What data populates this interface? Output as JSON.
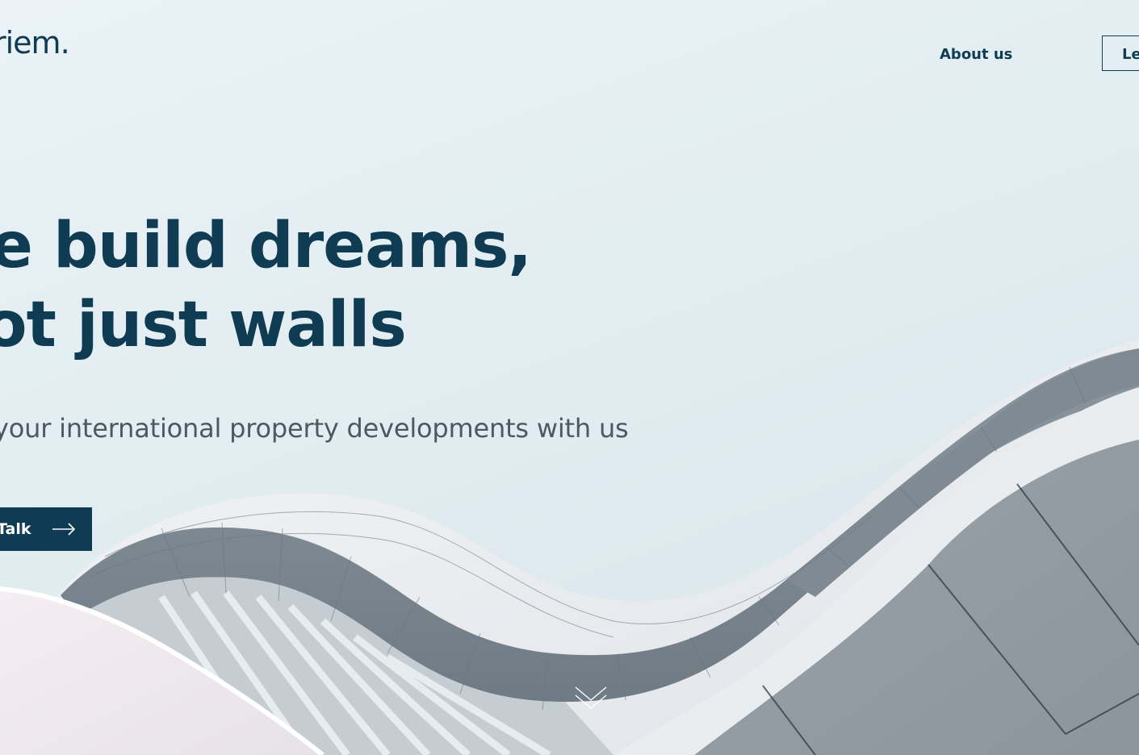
{
  "header": {
    "logo_text": "riem.",
    "nav": {
      "about_label": "About us",
      "cta_label": "Le"
    }
  },
  "hero": {
    "title_line_1": "e build dreams,",
    "title_line_2": "ot just walls",
    "subtitle": "your international property developments with us",
    "cta_label": "Talk",
    "cta_icon": "arrow-right-icon"
  },
  "scroll": {
    "icon": "chevron-down-icon"
  },
  "colors": {
    "brand": "#0f3c52",
    "text_muted": "#4c5a60",
    "background": "#e3eef2"
  }
}
